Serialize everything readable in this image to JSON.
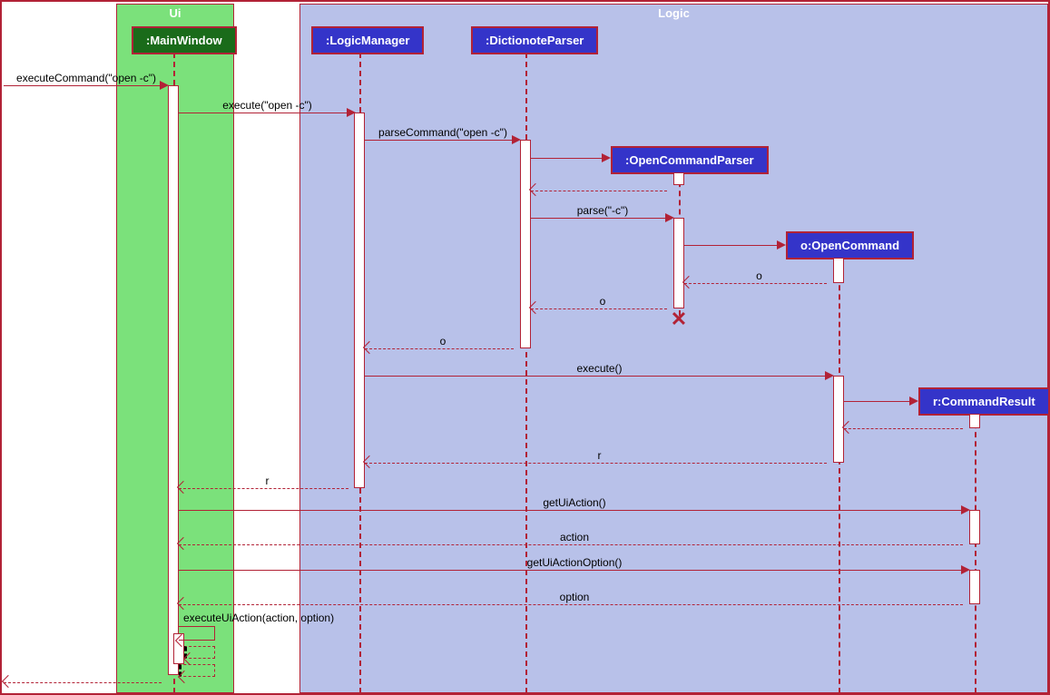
{
  "regions": {
    "ui": {
      "title": "Ui"
    },
    "logic": {
      "title": "Logic"
    }
  },
  "participants": {
    "main_window": ":MainWindow",
    "logic_manager": ":LogicManager",
    "dictionote_parser": ":DictionoteParser",
    "open_command_parser": ":OpenCommandParser",
    "open_command": "o:OpenCommand",
    "command_result": "r:CommandResult"
  },
  "messages": {
    "m1": "executeCommand(\"open -c\")",
    "m2": "execute(\"open -c\")",
    "m3": "parseCommand(\"open -c\")",
    "m4": "",
    "m5": "parse(\"-c\")",
    "m6": "",
    "m7_o": "o",
    "m8_o": "o",
    "m9_o": "o",
    "m10": "execute()",
    "m11": "",
    "m12_r": "r",
    "m13_r": "r",
    "m14": "getUiAction()",
    "m15": "action",
    "m16": "getUiActionOption()",
    "m17": "option",
    "m18": "executeUiAction(action, option)",
    "m19": "",
    "m20": ""
  }
}
